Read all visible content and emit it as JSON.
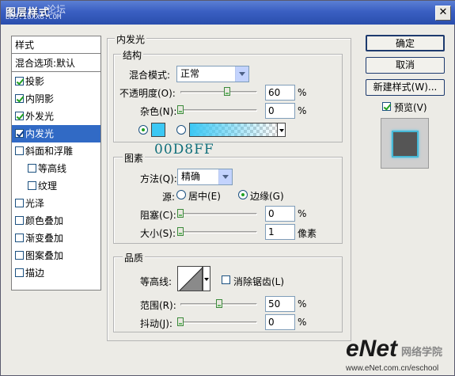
{
  "window": {
    "title": "图层样式",
    "watermark_top": "论坛",
    "watermark_url": "BBS.16XX8.COM"
  },
  "left_panel": {
    "header": "样式",
    "blend_options": "混合选项:默认",
    "items": [
      {
        "label": "投影",
        "checked": true
      },
      {
        "label": "内阴影",
        "checked": true
      },
      {
        "label": "外发光",
        "checked": true
      },
      {
        "label": "内发光",
        "checked": true,
        "selected": true
      },
      {
        "label": "斜面和浮雕",
        "checked": false
      },
      {
        "label": "等高线",
        "checked": false,
        "indent": true
      },
      {
        "label": "纹理",
        "checked": false,
        "indent": true
      },
      {
        "label": "光泽",
        "checked": false
      },
      {
        "label": "颜色叠加",
        "checked": false
      },
      {
        "label": "渐变叠加",
        "checked": false
      },
      {
        "label": "图案叠加",
        "checked": false
      },
      {
        "label": "描边",
        "checked": false
      }
    ]
  },
  "inner_glow": {
    "title": "内发光",
    "structure": {
      "title": "结构",
      "blend_mode_label": "混合模式:",
      "blend_mode_value": "正常",
      "opacity_label": "不透明度(O):",
      "opacity_value": "60",
      "opacity_unit": "%",
      "noise_label": "杂色(N):",
      "noise_value": "0",
      "noise_unit": "%",
      "color_hex_note": "00D8FF",
      "color": "#3cc8f4"
    },
    "elements": {
      "title": "图素",
      "technique_label": "方法(Q):",
      "technique_value": "精确",
      "source_label": "源:",
      "source_center": "居中(E)",
      "source_edge": "边缘(G)",
      "choke_label": "阻塞(C):",
      "choke_value": "0",
      "choke_unit": "%",
      "size_label": "大小(S):",
      "size_value": "1",
      "size_unit": "像素"
    },
    "quality": {
      "title": "品质",
      "contour_label": "等高线:",
      "antialias_label": "消除锯齿(L)",
      "range_label": "范围(R):",
      "range_value": "50",
      "range_unit": "%",
      "jitter_label": "抖动(J):",
      "jitter_value": "0",
      "jitter_unit": "%"
    }
  },
  "buttons": {
    "ok": "确定",
    "cancel": "取消",
    "new_style": "新建样式(W)...",
    "preview": "预览(V)"
  },
  "footer": {
    "brand": "eNet",
    "brand_cn": "网络学院",
    "url": "www.eNet.com.cn/eschool"
  }
}
